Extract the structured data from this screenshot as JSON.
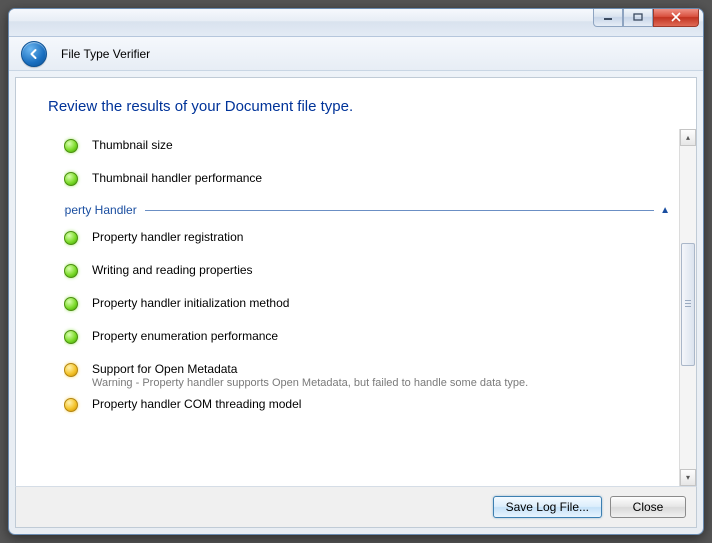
{
  "window": {
    "app_title": "File Type Verifier"
  },
  "heading": "Review the results of your Document file type.",
  "items_top": [
    {
      "status": "green",
      "label": "Thumbnail size"
    },
    {
      "status": "green",
      "label": "Thumbnail handler performance"
    }
  ],
  "section": {
    "title": "Property Handler",
    "expanded": true
  },
  "items_section": [
    {
      "status": "green",
      "label": "Property handler registration"
    },
    {
      "status": "green",
      "label": "Writing and reading properties"
    },
    {
      "status": "green",
      "label": "Property handler initialization method"
    },
    {
      "status": "green",
      "label": "Property enumeration performance"
    },
    {
      "status": "yellow",
      "label": "Support for Open Metadata",
      "desc": "Warning - Property handler supports Open Metadata, but failed to handle some data type."
    },
    {
      "status": "yellow",
      "label": "Property handler COM threading model"
    }
  ],
  "footer": {
    "save_label": "Save Log File...",
    "close_label": "Close"
  },
  "scrollbar": {
    "thumb_top_pct": 30,
    "thumb_height_pct": 38
  }
}
